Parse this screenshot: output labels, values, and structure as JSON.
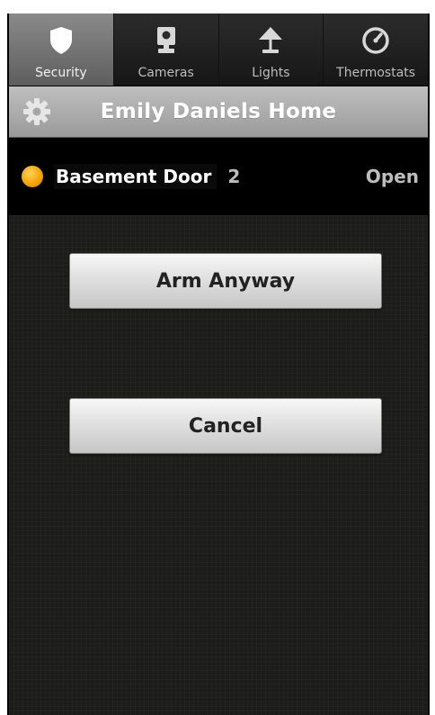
{
  "tabs": [
    {
      "label": "Security",
      "icon": "shield-icon",
      "active": true
    },
    {
      "label": "Cameras",
      "icon": "camera-icon",
      "active": false
    },
    {
      "label": "Lights",
      "icon": "lamp-icon",
      "active": false
    },
    {
      "label": "Thermostats",
      "icon": "thermostat-icon",
      "active": false
    }
  ],
  "header": {
    "title": "Emily Daniels Home",
    "settings_icon": "gear-icon"
  },
  "status": {
    "device_name": "Basement Door",
    "count": "2",
    "state": "Open",
    "indicator_color": "#f2a100"
  },
  "actions": {
    "arm_anyway_label": "Arm Anyway",
    "cancel_label": "Cancel"
  }
}
